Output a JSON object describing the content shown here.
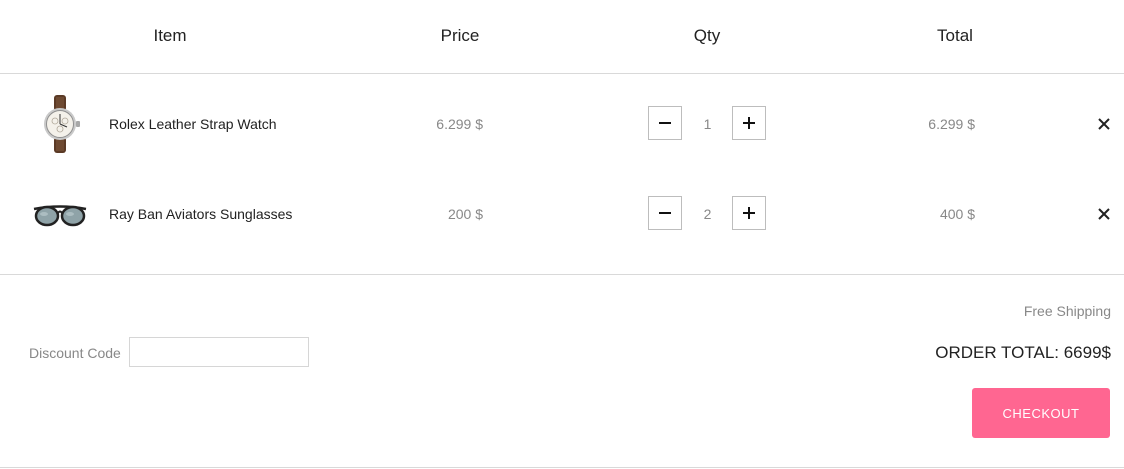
{
  "header": {
    "item_label": "Item",
    "price_label": "Price",
    "qty_label": "Qty",
    "total_label": "Total"
  },
  "items": [
    {
      "name": "Rolex Leather Strap Watch",
      "price": "6.299 $",
      "qty": "1",
      "total": "6.299 $",
      "image_icon": "watch-image"
    },
    {
      "name": "Ray Ban Aviators Sunglasses",
      "price": "200 $",
      "qty": "2",
      "total": "400 $",
      "image_icon": "sunglasses-image"
    }
  ],
  "summary": {
    "shipping": "Free Shipping",
    "discount_label": "Discount Code",
    "discount_value": "",
    "order_total": "ORDER TOTAL: 6699$",
    "checkout_label": "CHECKOUT"
  },
  "colors": {
    "accent": "#ff6691",
    "muted_text": "#888888",
    "border": "#d9d9d9"
  }
}
